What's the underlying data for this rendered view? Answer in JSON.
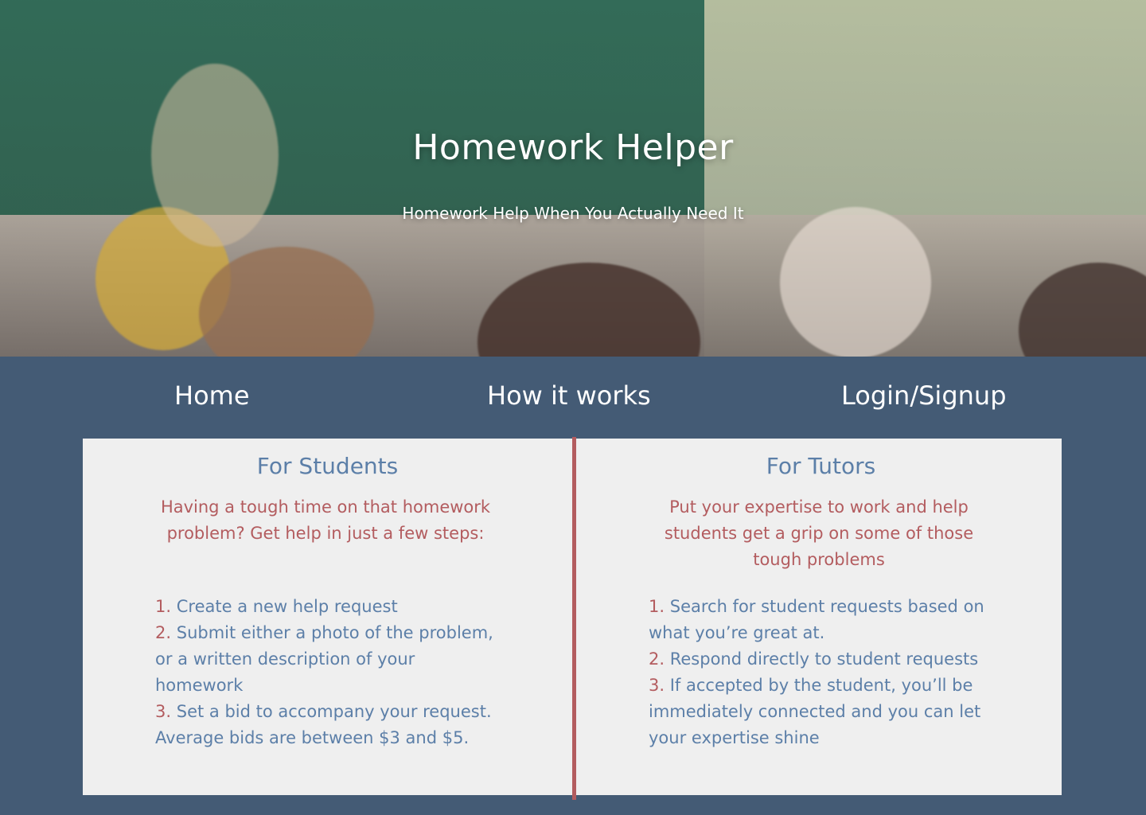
{
  "hero": {
    "title": "Homework Helper",
    "subtitle": "Homework Help When You Actually Need It"
  },
  "nav": {
    "home": "Home",
    "how": "How it works",
    "login": "Login/Signup"
  },
  "students": {
    "heading": "For Students",
    "intro": "Having a tough time on that homework problem?  Get help in just a few steps:",
    "steps": [
      {
        "num": "1.",
        "text": "Create a new help request"
      },
      {
        "num": "2.",
        "text": "Submit either a photo of the problem, or a written description of your homework"
      },
      {
        "num": "3.",
        "text": "Set a bid to accompany your request.  Average bids are between $3 and $5."
      }
    ]
  },
  "tutors": {
    "heading": "For Tutors",
    "intro": "Put your expertise to work and help students get a grip on some of those tough problems",
    "steps": [
      {
        "num": "1.",
        "text": "Search for student requests based on what you’re great at."
      },
      {
        "num": "2.",
        "text": "Respond directly to student requests"
      },
      {
        "num": "3.",
        "text": "If accepted by the student, you’ll be immediately connected and you can let your expertise shine"
      }
    ]
  },
  "colors": {
    "navy": "#445b75",
    "panel": "#efefef",
    "blue_text": "#5c7fa8",
    "accent_red": "#b35c5f"
  }
}
